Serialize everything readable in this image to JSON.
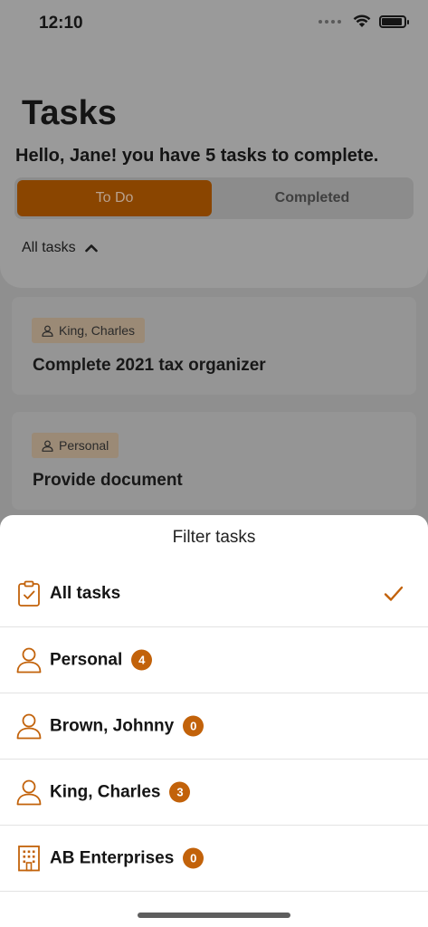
{
  "status_bar": {
    "time": "12:10"
  },
  "header": {
    "title": "Tasks",
    "greeting": "Hello, Jane! you have 5 tasks to complete."
  },
  "segments": {
    "todo": "To Do",
    "completed": "Completed",
    "selected": "todo"
  },
  "filter_toggle": {
    "label": "All tasks",
    "icon": "chevron-up-icon"
  },
  "tasks": [
    {
      "tag": "King, Charles",
      "tag_icon": "person-icon",
      "title": "Complete 2021 tax organizer"
    },
    {
      "tag": "Personal",
      "tag_icon": "person-icon",
      "title": "Provide document"
    }
  ],
  "sheet": {
    "title": "Filter tasks",
    "options": [
      {
        "label": "All tasks",
        "icon": "clipboard-check-icon",
        "selected": true
      },
      {
        "label": "Personal",
        "icon": "person-icon",
        "count": "4"
      },
      {
        "label": "Brown, Johnny",
        "icon": "person-icon",
        "count": "0"
      },
      {
        "label": "King, Charles",
        "icon": "person-icon",
        "count": "3"
      },
      {
        "label": "AB Enterprises",
        "icon": "building-icon",
        "count": "0"
      }
    ]
  },
  "colors": {
    "accent": "#c2620a",
    "segment_selected": "#8a4500",
    "tag_bg": "#9b8a76"
  }
}
